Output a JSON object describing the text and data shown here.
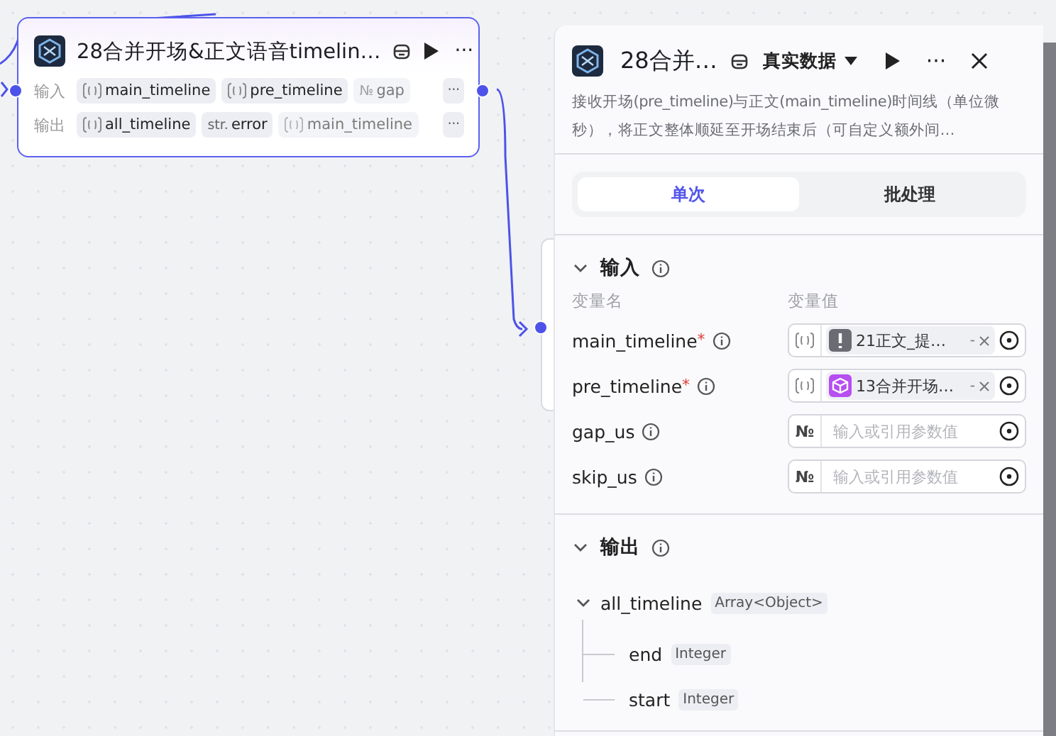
{
  "node": {
    "title": "28合并开场&正文语音timelin…",
    "rows": [
      {
        "label": "输入",
        "chips": [
          {
            "kind": "array",
            "name": "main_timeline",
            "faded": false
          },
          {
            "kind": "array",
            "name": "pre_timeline",
            "faded": false
          },
          {
            "kind": "number",
            "mark": "№",
            "name": "gap",
            "faded": true
          }
        ]
      },
      {
        "label": "输出",
        "chips": [
          {
            "kind": "array",
            "name": "all_timeline",
            "faded": false
          },
          {
            "kind": "string",
            "mark": "str.",
            "name": "error",
            "faded": false
          },
          {
            "kind": "array",
            "name": "main_timeline",
            "faded": true
          }
        ]
      }
    ],
    "more": "···"
  },
  "panel": {
    "title": "28合并…",
    "data_source": "真实数据",
    "description": "接收开场(pre_timeline)与正文(main_timeline)时间线（单位微秒），将正文整体顺延至开场结束后（可自定义额外间…",
    "tabs": [
      {
        "label": "单次",
        "selected": true
      },
      {
        "label": "批处理",
        "selected": false
      }
    ],
    "input_section": {
      "title": "输入",
      "expanded": true,
      "col_name": "变量名",
      "col_value": "变量值",
      "rows": [
        {
          "name": "main_timeline",
          "required_mark": "*",
          "kind": "array",
          "value": {
            "text": "21正文_提…",
            "kind": "alert",
            "color": "#6b6b73",
            "suffix": "-"
          }
        },
        {
          "name": "pre_timeline",
          "required_mark": "*",
          "kind": "array",
          "value": {
            "text": "13合并开场…",
            "kind": "cube",
            "color": "#b64ef0",
            "suffix": "-"
          }
        },
        {
          "name": "gap_us",
          "kind": "number",
          "mark": "№",
          "placeholder": "输入或引用参数值"
        },
        {
          "name": "skip_us",
          "kind": "number",
          "mark": "№",
          "placeholder": "输入或引用参数值"
        }
      ]
    },
    "output_section": {
      "title": "输出",
      "expanded": true,
      "tree": [
        {
          "name": "all_timeline",
          "type": "Array<Object>",
          "expanded": true,
          "children": [
            {
              "name": "end",
              "type": "Integer"
            },
            {
              "name": "start",
              "type": "Integer"
            }
          ]
        }
      ]
    }
  }
}
